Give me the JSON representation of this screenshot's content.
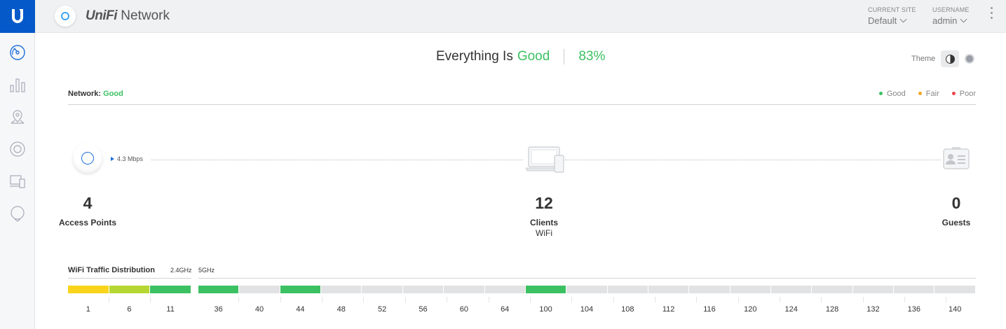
{
  "app": {
    "brand_italic": "UniFi",
    "brand_rest": " Network"
  },
  "header": {
    "site_label": "CURRENT SITE",
    "site_value": "Default",
    "user_label": "USERNAME",
    "user_value": "admin"
  },
  "sidebar": {
    "items": [
      {
        "name": "dashboard-icon",
        "active": true
      },
      {
        "name": "statistics-icon",
        "active": false
      },
      {
        "name": "map-icon",
        "active": false
      },
      {
        "name": "devices-icon",
        "active": false
      },
      {
        "name": "clients-icon",
        "active": false
      },
      {
        "name": "insights-icon",
        "active": false
      }
    ]
  },
  "status": {
    "prefix": "Everything Is",
    "state": "Good",
    "percent": "83%"
  },
  "theme": {
    "label": "Theme"
  },
  "network": {
    "label": "Network:",
    "state": "Good",
    "legend": [
      {
        "label": "Good",
        "color": "#3cc162"
      },
      {
        "label": "Fair",
        "color": "#f5a623"
      },
      {
        "label": "Poor",
        "color": "#e8474a"
      }
    ]
  },
  "topology": {
    "speed": "4.3 Mbps",
    "access_points": {
      "count": "4",
      "label": "Access Points"
    },
    "clients": {
      "count": "12",
      "label": "Clients",
      "sub": "WiFi"
    },
    "guests": {
      "count": "0",
      "label": "Guests"
    }
  },
  "traffic": {
    "title": "WiFi Traffic Distribution",
    "band_24_label": "2.4GHz",
    "band_5_label": "5GHz",
    "colors": {
      "yellow": "#f9d41b",
      "lime": "#b6d633",
      "green": "#3cc162",
      "empty": "#e1e2e4"
    },
    "band_24": [
      {
        "channel": "1",
        "color": "yellow"
      },
      {
        "channel": "6",
        "color": "lime"
      },
      {
        "channel": "11",
        "color": "green"
      }
    ],
    "band_5": [
      {
        "channel": "36",
        "color": "green"
      },
      {
        "channel": "40",
        "color": "empty"
      },
      {
        "channel": "44",
        "color": "green"
      },
      {
        "channel": "48",
        "color": "empty"
      },
      {
        "channel": "52",
        "color": "empty"
      },
      {
        "channel": "56",
        "color": "empty"
      },
      {
        "channel": "60",
        "color": "empty"
      },
      {
        "channel": "64",
        "color": "empty"
      },
      {
        "channel": "100",
        "color": "green"
      },
      {
        "channel": "104",
        "color": "empty"
      },
      {
        "channel": "108",
        "color": "empty"
      },
      {
        "channel": "112",
        "color": "empty"
      },
      {
        "channel": "116",
        "color": "empty"
      },
      {
        "channel": "120",
        "color": "empty"
      },
      {
        "channel": "124",
        "color": "empty"
      },
      {
        "channel": "128",
        "color": "empty"
      },
      {
        "channel": "132",
        "color": "empty"
      },
      {
        "channel": "136",
        "color": "empty"
      },
      {
        "channel": "140",
        "color": "empty"
      }
    ]
  }
}
